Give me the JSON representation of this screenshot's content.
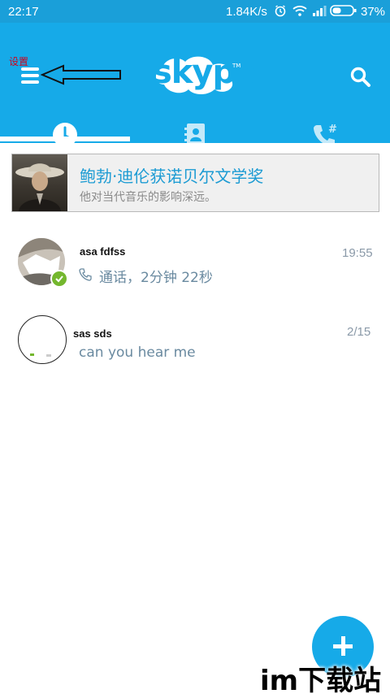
{
  "status_bar": {
    "time": "22:17",
    "speed": "1.84K/s",
    "battery": "37%",
    "icons": [
      "alarm-icon",
      "wifi-icon",
      "signal-icon",
      "battery-icon"
    ]
  },
  "header": {
    "logo": "skype",
    "logo_tm": "TM",
    "annotation": "设置",
    "tabs": [
      {
        "name": "recent",
        "icon": "clock-icon"
      },
      {
        "name": "contacts",
        "icon": "contacts-book-icon"
      },
      {
        "name": "dialpad",
        "icon": "phone-hash-icon"
      }
    ]
  },
  "banner": {
    "title": "鲍勃·迪伦获诺贝尔文学奖",
    "subtitle": "他对当代音乐的影响深远。"
  },
  "conversations": [
    {
      "name": "asa    fdfss",
      "time": "19:55",
      "preview": "通话，2分钟 22秒",
      "status": "online"
    },
    {
      "name": "sas                  sds",
      "time": "2/15",
      "preview": "can you hear me"
    }
  ],
  "watermark": "im下载站",
  "colors": {
    "accent": "#16aae8",
    "status_bar": "#1a9fd9",
    "online": "#74b72e",
    "annotation": "#d0021b"
  }
}
